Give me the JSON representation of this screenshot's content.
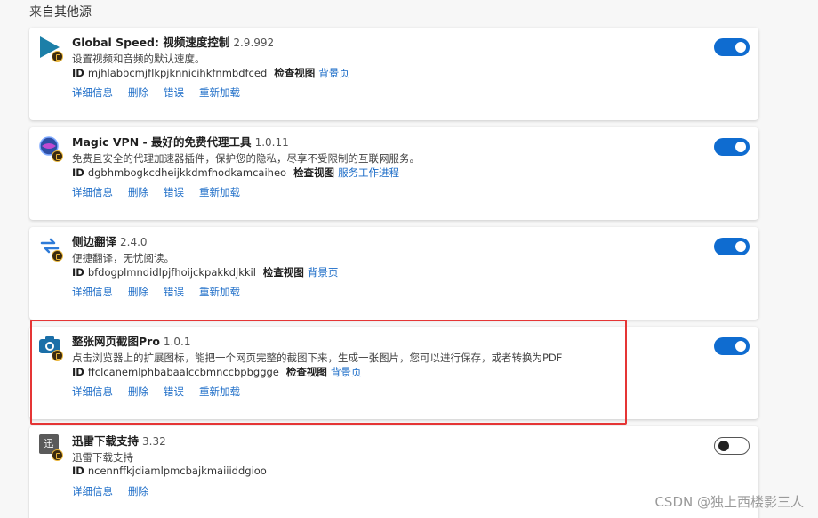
{
  "section_title": "来自其他源",
  "labels": {
    "id": "ID",
    "inspect_views": "检查视图",
    "details": "详细信息",
    "remove": "删除",
    "errors": "错误",
    "reload": "重新加载"
  },
  "extensions": [
    {
      "name": "Global Speed: 视频速度控制",
      "version": "2.9.992",
      "description": "设置视频和音频的默认速度。",
      "id": "mjhlabbcmjflkpjknnicihkfnmbdfced",
      "view_link": "背景页",
      "enabled": true,
      "icon": "play-triangle-icon"
    },
    {
      "name": "Magic VPN - 最好的免费代理工具",
      "version": "1.0.11",
      "description": "免费且安全的代理加速器插件，保护您的隐私，尽享不受限制的互联网服务。",
      "id": "dgbhmbogkcdheijkkdmfhodkamcaiheo",
      "view_link": "服务工作进程",
      "enabled": true,
      "icon": "magic-globe-icon"
    },
    {
      "name": "侧边翻译",
      "version": "2.4.0",
      "description": "便捷翻译，无忧阅读。",
      "id": "bfdogplmndidlpjfhoijckpakkdjkkil",
      "view_link": "背景页",
      "enabled": true,
      "icon": "translate-arrows-icon"
    },
    {
      "name": "整张网页截图Pro",
      "version": "1.0.1",
      "description": "点击浏览器上的扩展图标，能把一个网页完整的截图下来，生成一张图片，您可以进行保存，或者转换为PDF",
      "id": "ffclcanemlphbabaalccbmnccbpbggge",
      "view_link": "背景页",
      "enabled": true,
      "icon": "camera-icon"
    },
    {
      "name": "迅雷下载支持",
      "version": "3.32",
      "description": "迅雷下载支持",
      "id": "ncennffkjdiamlpmcbajkmaiiiddgioo",
      "view_link": "",
      "enabled": false,
      "icon": "xunlei-icon",
      "icon_text": "迅"
    }
  ],
  "watermark": "CSDN @独上西楼影三人",
  "colors": {
    "toggle_on": "#0f6cd0",
    "link": "#1a6bc7",
    "highlight": "#e53535"
  }
}
